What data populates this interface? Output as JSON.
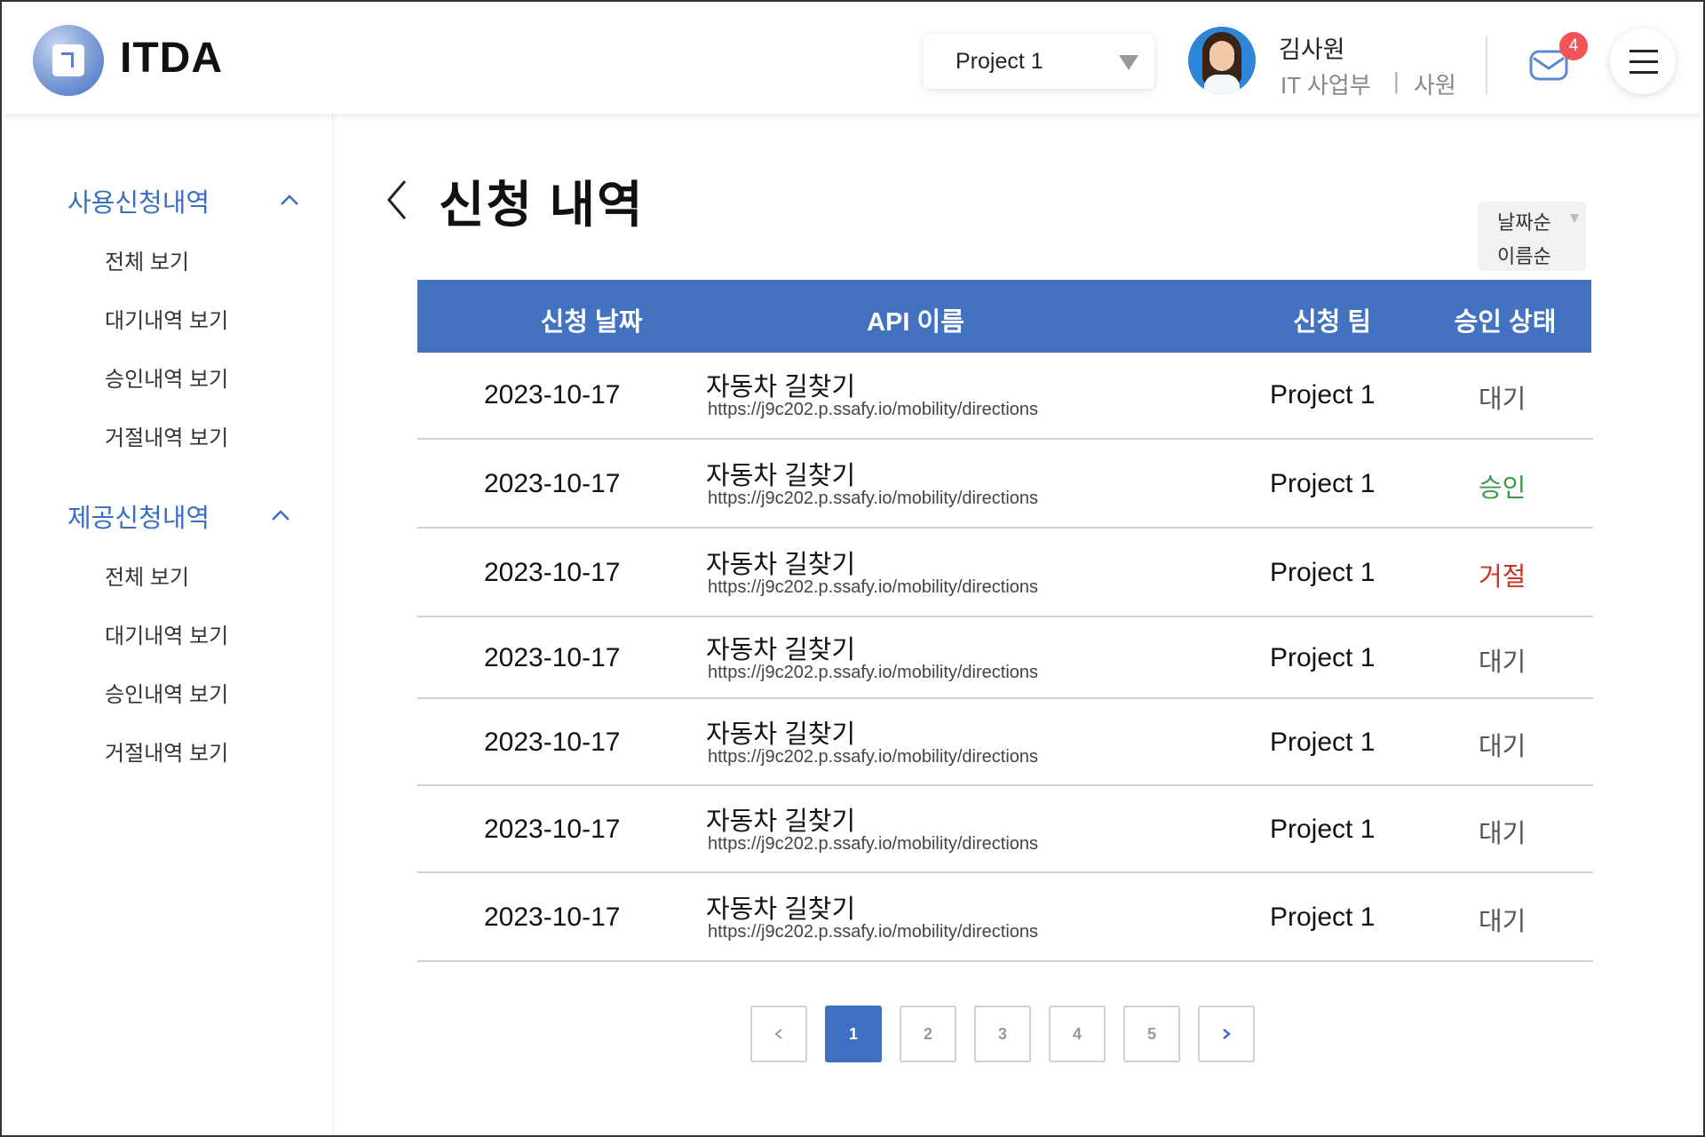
{
  "header": {
    "logo_text": "ITDA",
    "project_select": "Project 1",
    "user_name": "김사원",
    "user_dept": "IT 사업부",
    "separator": "|",
    "user_rank": "사원",
    "mail_badge": "4"
  },
  "sidebar": {
    "groups": [
      {
        "title": "사용신청내역",
        "items": [
          "전체 보기",
          "대기내역 보기",
          "승인내역 보기",
          "거절내역 보기"
        ]
      },
      {
        "title": "제공신청내역",
        "items": [
          "전체 보기",
          "대기내역 보기",
          "승인내역 보기",
          "거절내역 보기"
        ]
      }
    ]
  },
  "main": {
    "title": "신청 내역",
    "sort_options": [
      "날짜순",
      "이름순"
    ],
    "table": {
      "headers": [
        "신청 날짜",
        "API 이름",
        "신청 팀",
        "승인 상태"
      ],
      "rows": [
        {
          "date": "2023-10-17",
          "api_name": "자동차 길찾기",
          "api_url": "https://j9c202.p.ssafy.io/mobility/directions",
          "team": "Project 1",
          "status": "대기"
        },
        {
          "date": "2023-10-17",
          "api_name": "자동차 길찾기",
          "api_url": "https://j9c202.p.ssafy.io/mobility/directions",
          "team": "Project 1",
          "status": "승인"
        },
        {
          "date": "2023-10-17",
          "api_name": "자동차 길찾기",
          "api_url": "https://j9c202.p.ssafy.io/mobility/directions",
          "team": "Project 1",
          "status": "거절"
        },
        {
          "date": "2023-10-17",
          "api_name": "자동차 길찾기",
          "api_url": "https://j9c202.p.ssafy.io/mobility/directions",
          "team": "Project 1",
          "status": "대기"
        },
        {
          "date": "2023-10-17",
          "api_name": "자동차 길찾기",
          "api_url": "https://j9c202.p.ssafy.io/mobility/directions",
          "team": "Project 1",
          "status": "대기"
        },
        {
          "date": "2023-10-17",
          "api_name": "자동차 길찾기",
          "api_url": "https://j9c202.p.ssafy.io/mobility/directions",
          "team": "Project 1",
          "status": "대기"
        },
        {
          "date": "2023-10-17",
          "api_name": "자동차 길찾기",
          "api_url": "https://j9c202.p.ssafy.io/mobility/directions",
          "team": "Project 1",
          "status": "대기"
        }
      ]
    },
    "status_colors": {
      "대기": "#555555",
      "승인": "#3d9a4a",
      "거절": "#cc3322"
    },
    "pagination": {
      "prev_icon": "chevron-left-icon",
      "pages": [
        "1",
        "2",
        "3",
        "4",
        "5"
      ],
      "current_page": "1",
      "next_icon": "chevron-right-icon"
    }
  },
  "colors": {
    "accent": "#4272c0",
    "sidebar_title": "#3a6fc0",
    "badge": "#f05454"
  }
}
